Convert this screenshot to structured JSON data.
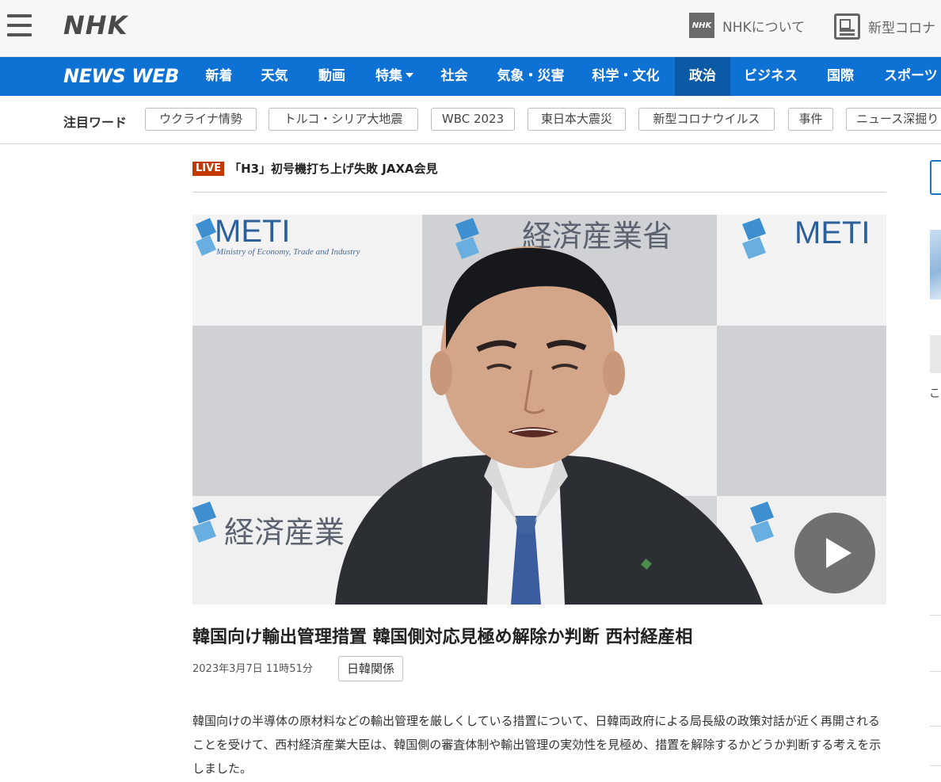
{
  "header": {
    "menu_icon": "hamburger-menu-icon",
    "logo": "NHK",
    "about_badge": "NHK",
    "about_label": "NHKについて",
    "covid_label": "新型コロナ"
  },
  "nav": {
    "logo": "NEWS WEB",
    "items": [
      {
        "label": "新着"
      },
      {
        "label": "天気"
      },
      {
        "label": "動画"
      },
      {
        "label": "特集"
      },
      {
        "label": "社会"
      },
      {
        "label": "気象・災害"
      },
      {
        "label": "科学・文化"
      },
      {
        "label": "政治"
      },
      {
        "label": "ビジネス"
      },
      {
        "label": "国際"
      },
      {
        "label": "スポーツ"
      }
    ],
    "active_item": "政治"
  },
  "trending": {
    "label": "注目ワード",
    "chips": [
      {
        "label": "ウクライナ情勢"
      },
      {
        "label": "トルコ・シリア大地震"
      },
      {
        "label": "WBC 2023"
      },
      {
        "label": "東日本大震災"
      },
      {
        "label": "新型コロナウイルス"
      },
      {
        "label": "事件"
      },
      {
        "label": "ニュース深掘り"
      }
    ]
  },
  "live": {
    "badge": "LIVE",
    "text": "「H3」初号機打ち上げ失敗 JAXA会見"
  },
  "video": {
    "backdrop_logo": "METI",
    "backdrop_subtitle": "Ministry of Economy, Trade and Industry",
    "backdrop_ministry": "経済産業省",
    "play_icon": "play-icon"
  },
  "article": {
    "headline": "韓国向け輸出管理措置 韓国側対応見極め解除か判断 西村経産相",
    "date": "2023年3月7日 11時51分",
    "tag": "日韓関係",
    "body": "韓国向けの半導体の原材料などの輸出管理を厳しくしている措置について、日韓両政府による局長級の政策対話が近く再開されることを受けて、西村経済産業大臣は、韓国側の審査体制や輸出管理の実効性を見極め、措置を解除するかどうか判断する考えを示しました。"
  },
  "sidebar": {
    "fragment_char": "こ"
  },
  "colors": {
    "nav_blue": "#0e72d4",
    "nav_active": "#0a5aa6",
    "live_red": "#c53700"
  }
}
